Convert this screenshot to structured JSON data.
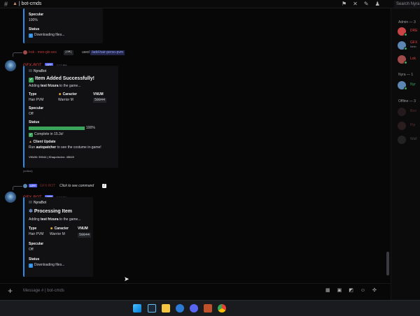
{
  "topbar": {
    "channel": "bot-cmds",
    "server_prefix": "| ",
    "search_placeholder": "Search Nyra"
  },
  "messages": {
    "first_embed": {
      "specular_label": "Specular",
      "specular_value": "100%",
      "status_label": "Status",
      "status_value": "Downloading files..."
    },
    "reply_line": {
      "author": "l•ok - mon-gls-ses",
      "tag": "[GM]",
      "used": "used",
      "command": "/add-hair-perso-pvm"
    },
    "second": {
      "bot_name": "GFX-BOT",
      "app_badge": "APP",
      "time": "7:17 PM",
      "embed_author": "NyraBot",
      "embed_title": "Item Added Successfully!",
      "desc_prefix": "Adding ",
      "desc_bold": "test frizura",
      "desc_suffix": " to the game...",
      "col1_label": "Type",
      "col2_label": "Caracter",
      "col3_label": "VNUM",
      "col1_value": "Hair PVM",
      "col2_value": "Warrior M",
      "col3_value": "50044",
      "specular_label": "Specular",
      "specular_value": "Off",
      "status_label": "Status",
      "progress_percent": "100%",
      "progress_fraction": 1.0,
      "complete_text": "Complete in 15.3s!",
      "client_update_label": "Client Update",
      "client_update_prefix": "Run ",
      "client_update_bold": "autopatcher",
      "client_update_suffix": " to see the costume in-game!",
      "footer": "VNUM: 50044 | ShapeIndex: 45649",
      "edited": "(edited)"
    },
    "third_reply": {
      "app_badge": "APP",
      "author": "GFX-BOT",
      "text": "Click to see command"
    },
    "third": {
      "bot_name": "GFX-BOT",
      "app_badge": "APP",
      "time": "7:17 PM",
      "embed_author": "NyraBot",
      "embed_title": "Processing Item",
      "desc_prefix": "Adding ",
      "desc_bold": "test frizura",
      "desc_suffix": " to the game...",
      "col1_label": "Type",
      "col2_label": "Caracter",
      "col3_label": "VNUM",
      "col1_value": "Hair PVM",
      "col2_value": "Warrior M",
      "col3_value": "50044",
      "specular_label": "Specular",
      "specular_value": "Off",
      "status_label": "Status",
      "status_value": "Downloading files..."
    }
  },
  "composer": {
    "placeholder": "Message #  | bot-cmds"
  },
  "members": {
    "admin_header": "Admin — 3",
    "admin_1": "DRE",
    "admin_2": "GFX",
    "admin_2_sub": "Metin",
    "admin_3": "Lok",
    "nyra_header": "Nyra — 1",
    "nyra_1": "Nyr",
    "offline_header": "Offline — 3",
    "offline_1": "Boo",
    "offline_2": "Pip",
    "offline_3": "Wall"
  },
  "colors": {
    "embed_accent": "#2d8ee6",
    "progress_green": "#3ba55c",
    "bot_name_red": "#e04040",
    "app_badge": "#5865f2"
  }
}
